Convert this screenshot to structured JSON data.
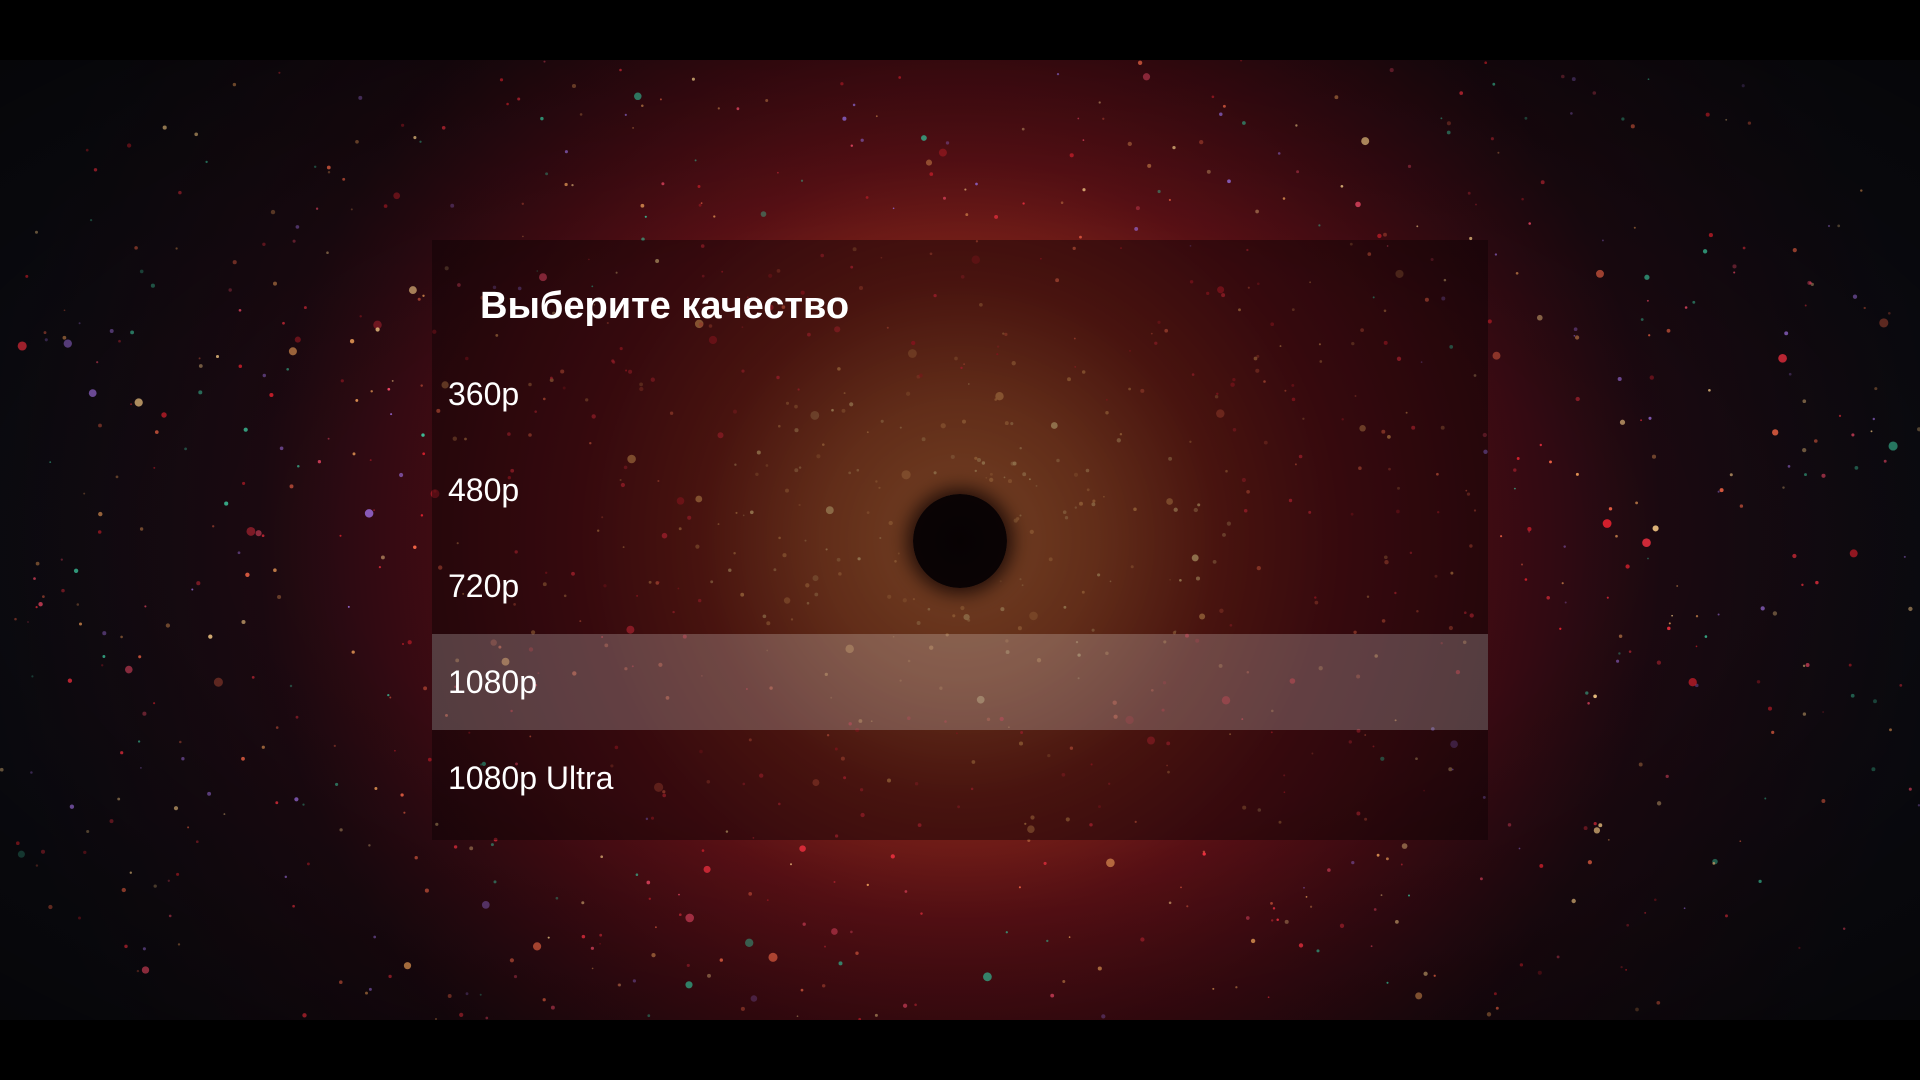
{
  "dialog": {
    "title": "Выберите качество",
    "options": [
      {
        "label": "360p",
        "selected": false
      },
      {
        "label": "480p",
        "selected": false
      },
      {
        "label": "720p",
        "selected": false
      },
      {
        "label": "1080p",
        "selected": true
      },
      {
        "label": "1080p Ultra",
        "selected": false
      }
    ]
  },
  "colors": {
    "selected_row_overlay": "#ffffff",
    "text": "#ffffff",
    "nebula_core": "#c9763e",
    "nebula_outer": "#7a2218"
  }
}
